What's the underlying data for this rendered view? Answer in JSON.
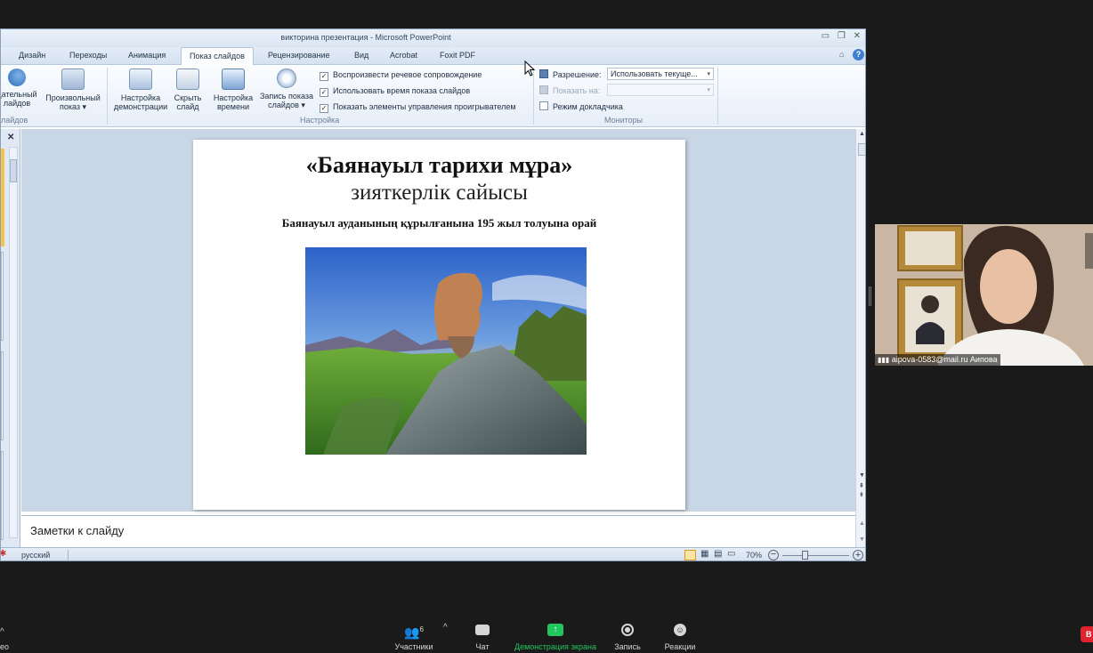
{
  "window": {
    "title": "викторина презентация  -  Microsoft PowerPoint",
    "controls": "▭ ❐ ✕"
  },
  "tabs": [
    "Дизайн",
    "Переходы",
    "Анимация",
    "Показ слайдов",
    "Рецензирование",
    "Вид",
    "Acrobat",
    "Foxit PDF"
  ],
  "active_tab": "Показ слайдов",
  "ribbon": {
    "btn_partial_1": "дательный\nлайдов",
    "btn_custom_show": "Произвольный\nпоказ ▾",
    "group_partial_label": "лайдов",
    "btn_setup": "Настройка\nдемонстрации",
    "btn_hide": "Скрыть\nслайд",
    "btn_rehearse": "Настройка\nвремени",
    "btn_record": "Запись показа\nслайдов ▾",
    "checks": [
      {
        "label": "Воспроизвести речевое сопровождение",
        "checked": true
      },
      {
        "label": "Использовать время показа слайдов",
        "checked": true
      },
      {
        "label": "Показать элементы управления проигрывателем",
        "checked": true
      }
    ],
    "group_setup_label": "Настройка",
    "resolution_label": "Разрешение:",
    "resolution_value": "Использовать текуще...",
    "show_on_label": "Показать на:",
    "presenter_view_label": "Режим докладчика",
    "group_monitors_label": "Мониторы"
  },
  "slide": {
    "title": "«Баянауыл тарихи мұра»",
    "subtitle": "зияткерлік сайысы",
    "caption": "Баянауыл ауданының құрылғанына 195 жыл толуына орай"
  },
  "notes_placeholder": "Заметки к слайду",
  "status": {
    "language": "русский",
    "zoom": "70%"
  },
  "meeting": {
    "participant_name": "aipova-0583@mail.ru Аипова",
    "participants_count": "6",
    "toolbar": {
      "video_partial": "ео",
      "participants": "Участники",
      "chat": "Чат",
      "share": "Демонстрация экрана",
      "record": "Запись",
      "reactions": "Реакции",
      "end_partial": "В"
    },
    "share_color": "#22c55e"
  }
}
